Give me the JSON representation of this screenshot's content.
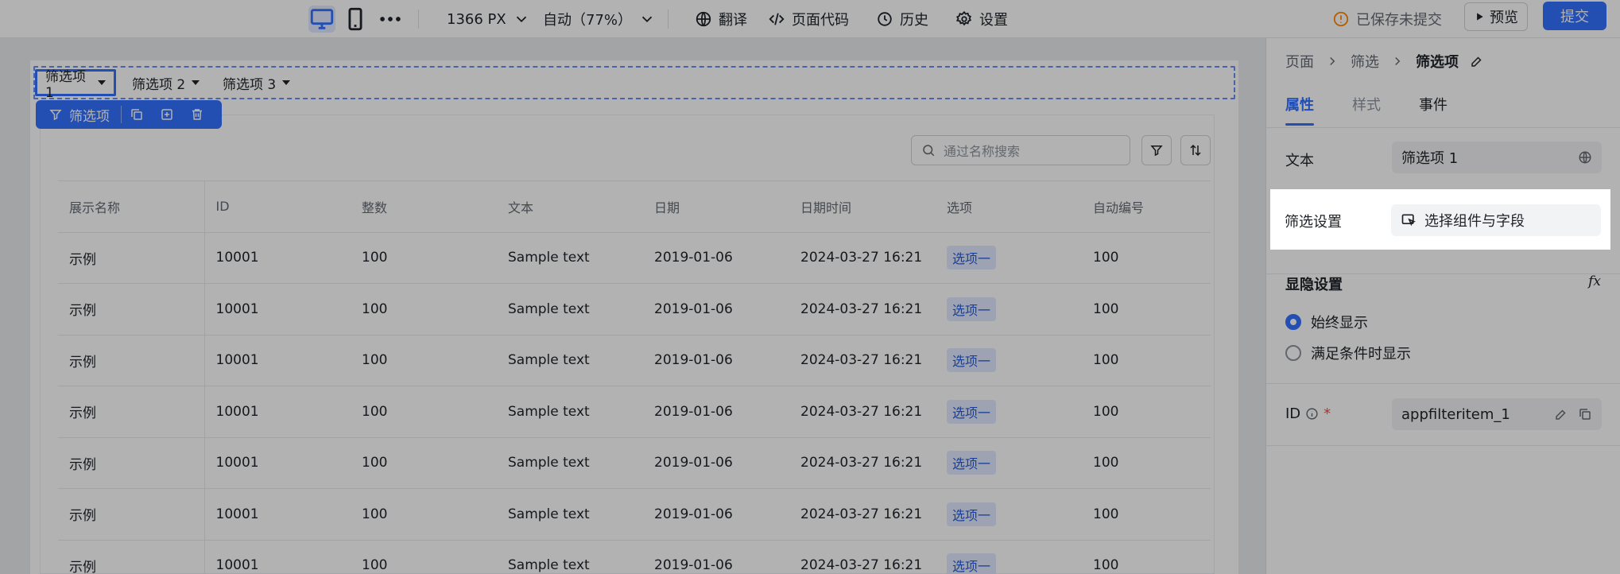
{
  "toolbar": {
    "width_label": "1366 PX",
    "zoom_label": "自动（77%）",
    "translate": "翻译",
    "code": "页面代码",
    "history": "历史",
    "settings": "设置",
    "save_status": "已保存未提交",
    "preview": "预览",
    "submit": "提交"
  },
  "filters": [
    "筛选项 1",
    "筛选项 2",
    "筛选项 3"
  ],
  "float_toolbar": {
    "label": "筛选项"
  },
  "search": {
    "placeholder": "通过名称搜索"
  },
  "table": {
    "columns": [
      "展示名称",
      "ID",
      "整数",
      "文本",
      "日期",
      "日期时间",
      "选项",
      "自动编号"
    ],
    "rows": [
      [
        "示例",
        "10001",
        "100",
        "Sample text",
        "2019-01-06",
        "2024-03-27 16:21",
        "选项一",
        "100"
      ],
      [
        "示例",
        "10001",
        "100",
        "Sample text",
        "2019-01-06",
        "2024-03-27 16:21",
        "选项一",
        "100"
      ],
      [
        "示例",
        "10001",
        "100",
        "Sample text",
        "2019-01-06",
        "2024-03-27 16:21",
        "选项一",
        "100"
      ],
      [
        "示例",
        "10001",
        "100",
        "Sample text",
        "2019-01-06",
        "2024-03-27 16:21",
        "选项一",
        "100"
      ],
      [
        "示例",
        "10001",
        "100",
        "Sample text",
        "2019-01-06",
        "2024-03-27 16:21",
        "选项一",
        "100"
      ],
      [
        "示例",
        "10001",
        "100",
        "Sample text",
        "2019-01-06",
        "2024-03-27 16:21",
        "选项一",
        "100"
      ],
      [
        "示例",
        "10001",
        "100",
        "Sample text",
        "2019-01-06",
        "2024-03-27 16:21",
        "选项一",
        "100"
      ]
    ]
  },
  "panel": {
    "breadcrumb": [
      "页面",
      "筛选",
      "筛选项"
    ],
    "tabs": [
      "属性",
      "样式",
      "事件"
    ],
    "text_label": "文本",
    "text_value": "筛选项 1",
    "filter_settings_label": "筛选设置",
    "filter_settings_value": "选择组件与字段",
    "visibility_label": "显隐设置",
    "fx": "fx",
    "visibility_options": [
      "始终显示",
      "满足条件时显示"
    ],
    "visibility_selected": 0,
    "id_label": "ID",
    "id_required": "*",
    "id_value": "appfilteritem_1"
  },
  "colors": {
    "accent": "#3370ff",
    "tag_bg": "#e1eaff",
    "tag_text": "#245bdb",
    "warning": "#ff8800"
  }
}
